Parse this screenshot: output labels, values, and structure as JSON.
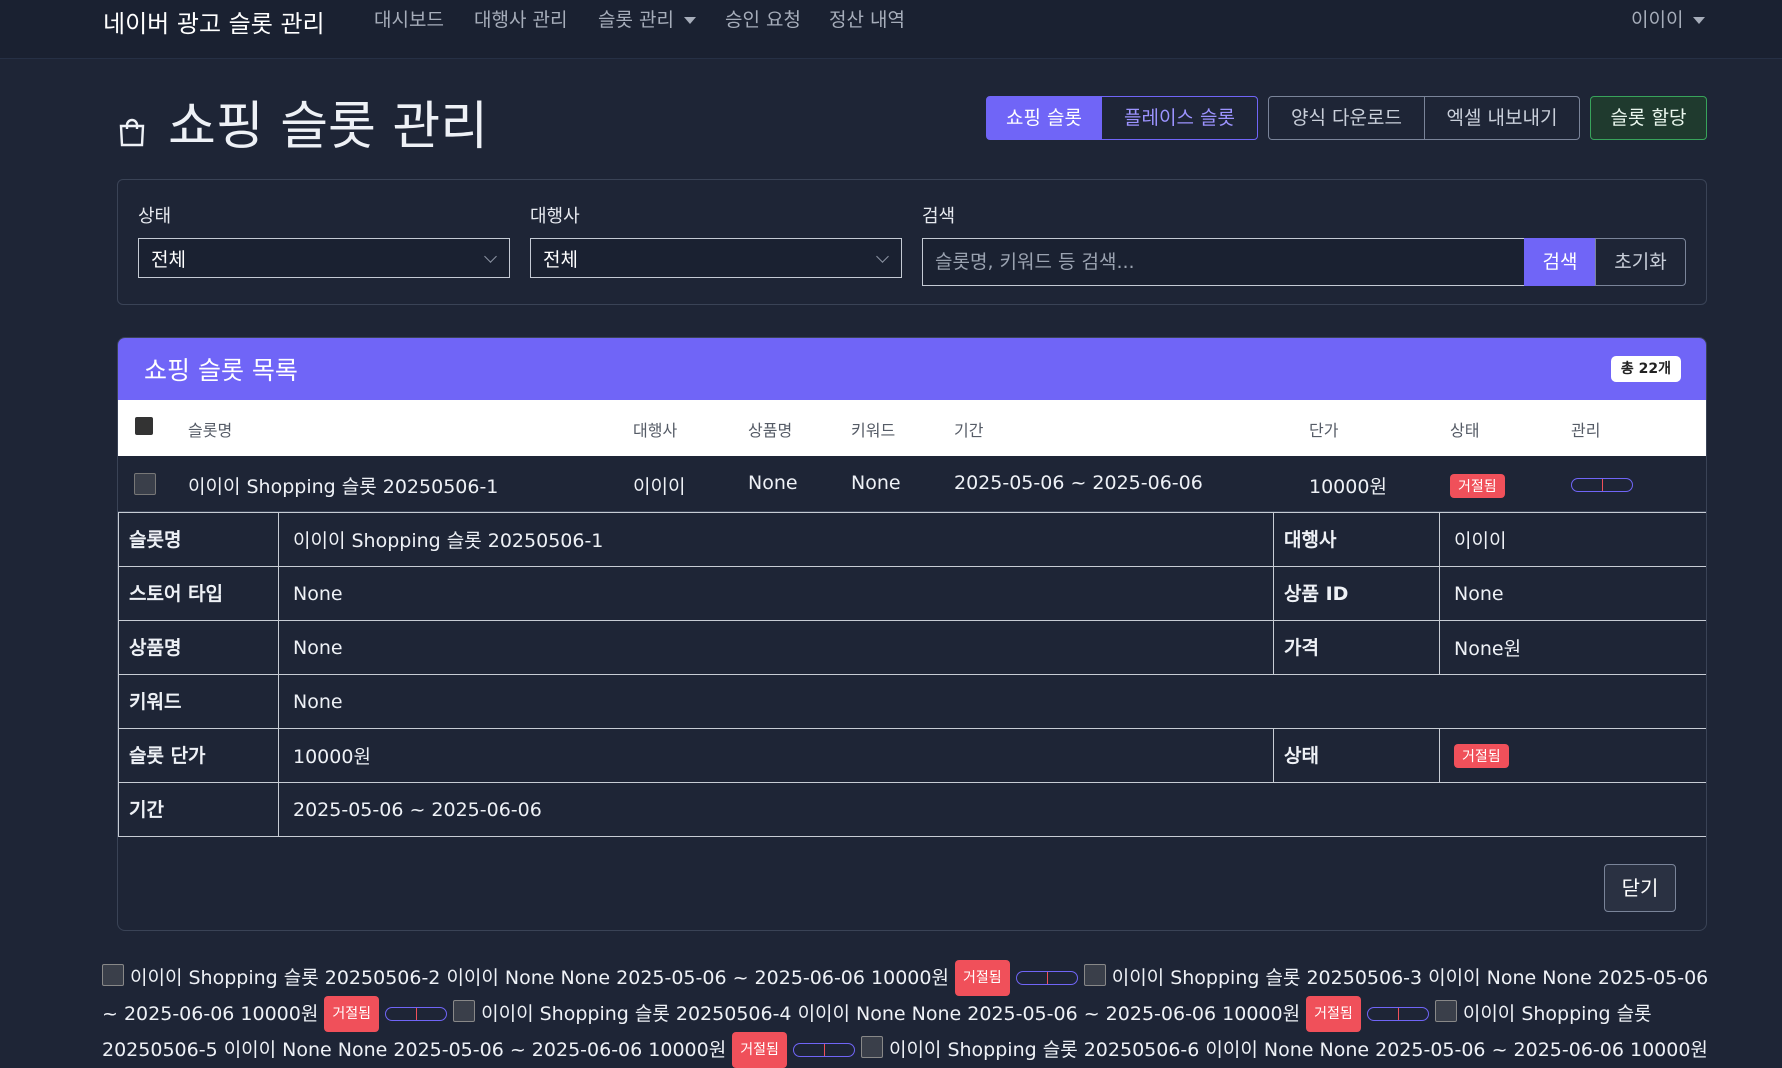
{
  "nav": {
    "brand": "네이버 광고 슬롯 관리",
    "items": [
      "대시보드",
      "대행사 관리",
      "슬롯 관리",
      "승인 요청",
      "정산 내역"
    ],
    "user": "이이이"
  },
  "header": {
    "title": "쇼핑 슬롯 관리",
    "tabs": [
      "쇼핑 슬롯",
      "플레이스 슬롯"
    ],
    "actions": [
      "양식 다운로드",
      "엑셀 내보내기"
    ],
    "assign": "슬롯 할당"
  },
  "filters": {
    "status_label": "상태",
    "status_value": "전체",
    "agency_label": "대행사",
    "agency_value": "전체",
    "search_label": "검색",
    "search_placeholder": "슬롯명, 키워드 등 검색...",
    "search_button": "검색",
    "reset_button": "초기화"
  },
  "list": {
    "title": "쇼핑 슬롯 목록",
    "count": "총 22개",
    "columns": [
      "슬롯명",
      "대행사",
      "상품명",
      "키워드",
      "기간",
      "단가",
      "상태",
      "관리"
    ],
    "row": {
      "name": "이이이 Shopping 슬롯 20250506-1",
      "agency": "이이이",
      "product": "None",
      "keyword": "None",
      "period": "2025-05-06 ~ 2025-06-06",
      "price": "10000원",
      "status": "거절됨"
    }
  },
  "detail": {
    "slot_name_k": "슬롯명",
    "slot_name_v": "이이이 Shopping 슬롯 20250506-1",
    "agency_k": "대행사",
    "agency_v": "이이이",
    "store_type_k": "스토어 타입",
    "store_type_v": "None",
    "product_id_k": "상품 ID",
    "product_id_v": "None",
    "product_name_k": "상품명",
    "product_name_v": "None",
    "price_k": "가격",
    "price_v": "None원",
    "keyword_k": "키워드",
    "keyword_v": "None",
    "unit_price_k": "슬롯 단가",
    "unit_price_v": "10000원",
    "status_k": "상태",
    "status_v": "거절됨",
    "period_k": "기간",
    "period_v": "2025-05-06 ~ 2025-06-06",
    "close": "닫기"
  },
  "overflow_rows": [
    "이이이 Shopping 슬롯 20250506-2 이이이 None None 2025-05-06 ~ 2025-06-06 10000원",
    "이이이 Shopping 슬롯 20250506-3 이이이 None None 2025-05-06 ~ 2025-06-06 10000원",
    "이이이 Shopping 슬롯 20250506-4 이이이 None None 2025-05-06 ~ 2025-06-06 10000원",
    "이이이 Shopping 슬롯 20250506-5 이이이 None None 2025-05-06 ~ 2025-06-06 10000원",
    "이이이 Shopping 슬롯 20250506-6 이이이 None None 2025-05-06 ~ 2025-06-06 10000원"
  ],
  "overflow_status": "거절됨"
}
